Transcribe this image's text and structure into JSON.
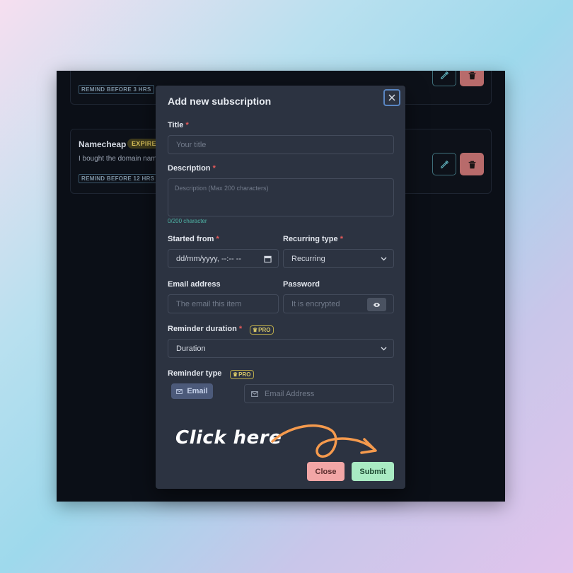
{
  "background_cards": [
    {
      "name": "",
      "status": "",
      "description": "",
      "remind": "REMIND BEFORE 3 HRS"
    },
    {
      "name": "Namecheap",
      "status": "EXPIRED",
      "description": "I bought the domain nam",
      "remind": "REMIND BEFORE 12 HRS"
    }
  ],
  "modal": {
    "title": "Add new subscription",
    "fields": {
      "title_label": "Title",
      "title_placeholder": "Your title",
      "description_label": "Description",
      "description_placeholder": "Description (Max 200 characters)",
      "description_counter": "0/200 character",
      "started_from_label": "Started from",
      "started_from_value": "dd/mm/yyyy, --:-- --",
      "recurring_type_label": "Recurring type",
      "recurring_type_value": "Recurring",
      "email_label": "Email address",
      "email_placeholder": "The email this item",
      "password_label": "Password",
      "password_placeholder": "It is encrypted",
      "reminder_duration_label": "Reminder duration",
      "reminder_duration_value": "Duration",
      "reminder_type_label": "Reminder type",
      "reminder_type_chip": "Email",
      "reminder_email_placeholder": "Email Address",
      "pro_badge": "PRO"
    },
    "buttons": {
      "close": "Close",
      "submit": "Submit"
    }
  },
  "annotation": {
    "text": "Click here"
  },
  "colors": {
    "accent_orange": "#f59a4d",
    "required_red": "#e55a5a",
    "submit_green": "#a9ebc3",
    "close_pink": "#f2a6a6",
    "counter_teal": "#4fb7a8"
  }
}
